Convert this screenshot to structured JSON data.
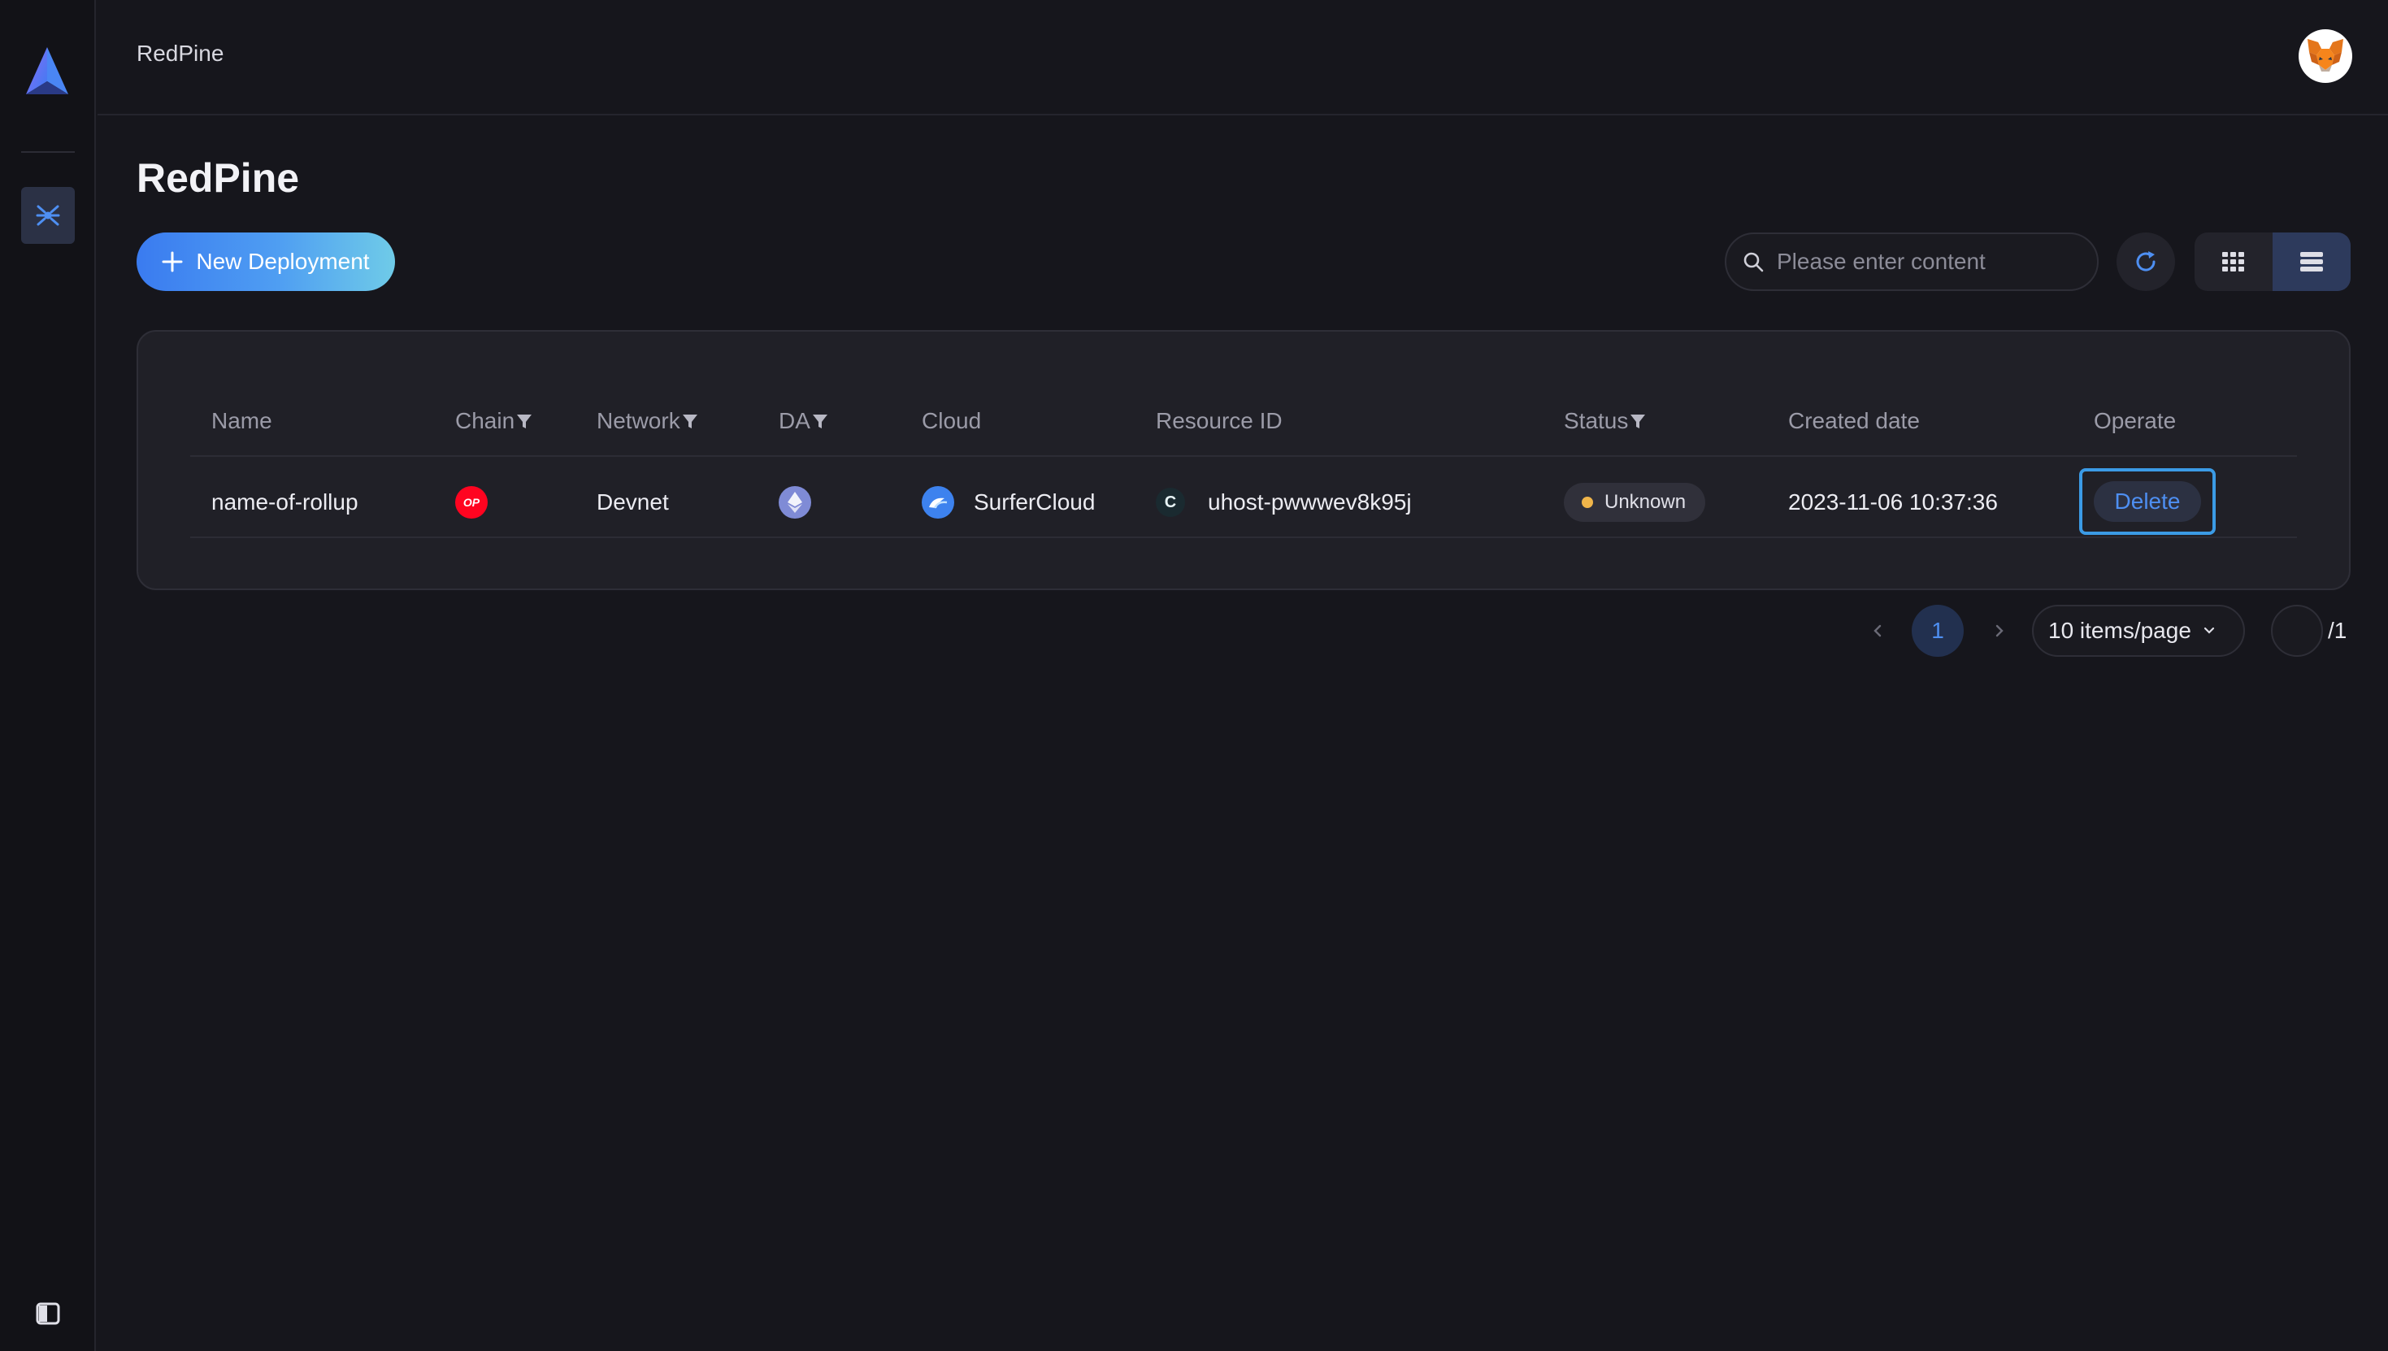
{
  "app": {
    "name": "RedPine"
  },
  "topbar": {
    "title": "RedPine"
  },
  "page": {
    "title": "RedPine"
  },
  "toolbar": {
    "new_button_label": "New Deployment",
    "search_placeholder": "Please enter content",
    "view_mode": "list"
  },
  "table": {
    "columns": [
      {
        "label": "Name",
        "filter": false
      },
      {
        "label": "Chain",
        "filter": true
      },
      {
        "label": "Network",
        "filter": true
      },
      {
        "label": "DA",
        "filter": true
      },
      {
        "label": "Cloud",
        "filter": false
      },
      {
        "label": "Resource ID",
        "filter": false
      },
      {
        "label": "Status",
        "filter": true
      },
      {
        "label": "Created date",
        "filter": false
      },
      {
        "label": "Operate",
        "filter": false
      }
    ],
    "rows": [
      {
        "name": "name-of-rollup",
        "chain_icon": "optimism-op-icon",
        "chain_icon_text": "OP",
        "network": "Devnet",
        "da_icon": "ethereum-icon",
        "cloud": "SurferCloud",
        "cloud_icon": "surfercloud-icon",
        "resource_icon_text": "C",
        "resource_id": "uhost-pwwwev8k95j",
        "status": "Unknown",
        "status_color": "#f0b54a",
        "created_date": "2023-11-06 10:37:36",
        "operate_label": "Delete"
      }
    ]
  },
  "pagination": {
    "current_page": "1",
    "page_size_label": "10 items/page",
    "total_label": "/1"
  },
  "colors": {
    "accent": "#4e8ff2",
    "background": "#16161c",
    "card": "#202027",
    "highlight_border": "#3b9be6"
  }
}
